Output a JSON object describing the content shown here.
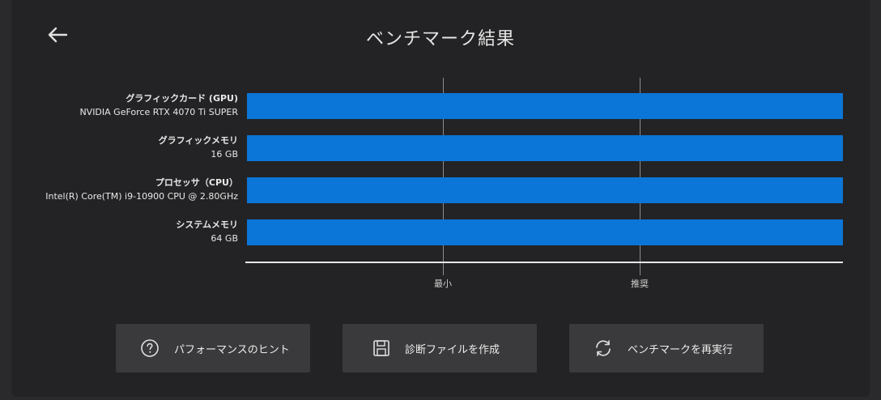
{
  "header": {
    "title": "ベンチマーク結果"
  },
  "rows": [
    {
      "name": "グラフィックカード (GPU)",
      "value": "NVIDIA GeForce RTX 4070 Ti SUPER"
    },
    {
      "name": "グラフィックメモリ",
      "value": "16 GB"
    },
    {
      "name": "プロセッサ（CPU）",
      "value": "Intel(R) Core(TM) i9-10900 CPU @ 2.80GHz"
    },
    {
      "name": "システムメモリ",
      "value": "64 GB"
    }
  ],
  "chart_data": {
    "type": "bar",
    "orientation": "horizontal",
    "categories": [
      "グラフィックカード (GPU)",
      "グラフィックメモリ",
      "プロセッサ（CPU）",
      "システムメモリ"
    ],
    "values": [
      1.0,
      1.0,
      1.0,
      1.0
    ],
    "markers": [
      "最小",
      "推奨"
    ],
    "grid": true
  },
  "ticks": {
    "min": "最小",
    "rec": "推奨"
  },
  "buttons": {
    "hints": "パフォーマンスのヒント",
    "diag": "診断ファイルを作成",
    "rerun": "ベンチマークを再実行"
  },
  "colors": {
    "bar": "#0b76d8",
    "background": "#232325",
    "button": "#3a3a3c"
  }
}
